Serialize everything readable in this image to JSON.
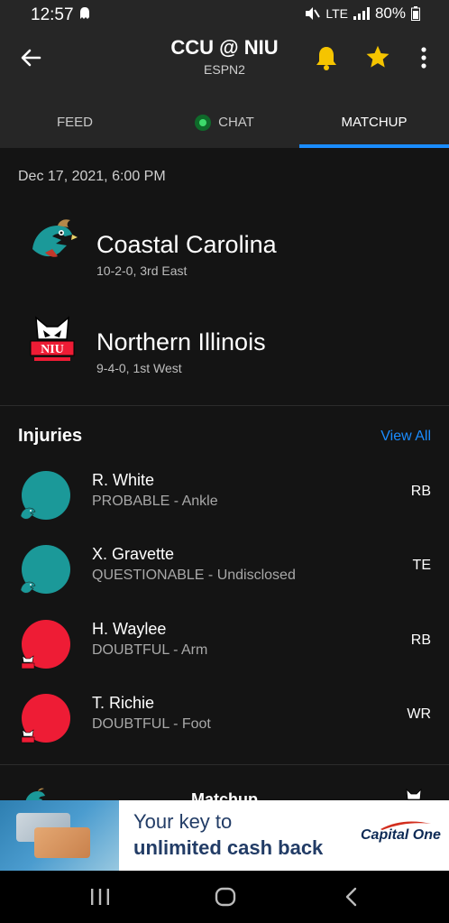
{
  "status_bar": {
    "time": "12:57",
    "signal_text": "LTE",
    "battery": "80%"
  },
  "header": {
    "title": "CCU @ NIU",
    "subtitle": "ESPN2"
  },
  "tabs": [
    {
      "label": "FEED"
    },
    {
      "label": "CHAT"
    },
    {
      "label": "MATCHUP"
    }
  ],
  "game": {
    "date": "Dec 17, 2021, 6:00 PM",
    "teams": [
      {
        "name": "Coastal Carolina",
        "record": "10-2-0, 3rd East",
        "logo_icon": "chanticleer-logo-icon"
      },
      {
        "name": "Northern Illinois",
        "record": "9-4-0, 1st West",
        "logo_icon": "huskie-logo-icon"
      }
    ]
  },
  "injuries": {
    "title": "Injuries",
    "view_all": "View All",
    "items": [
      {
        "name": "R. White",
        "status": "PROBABLE - Ankle",
        "position": "RB",
        "color": "#1b9999",
        "team": "ccu"
      },
      {
        "name": "X. Gravette",
        "status": "QUESTIONABLE - Undisclosed",
        "position": "TE",
        "color": "#1b9999",
        "team": "ccu"
      },
      {
        "name": "H. Waylee",
        "status": "DOUBTFUL - Arm",
        "position": "RB",
        "color": "#ee1c35",
        "team": "niu"
      },
      {
        "name": "T. Richie",
        "status": "DOUBTFUL - Foot",
        "position": "WR",
        "color": "#ee1c35",
        "team": "niu"
      }
    ]
  },
  "matchup_section": {
    "title": "Matchup"
  },
  "ad": {
    "line1": "Your key to",
    "line2": "unlimited cash back",
    "brand": "Capital One"
  },
  "colors": {
    "accent": "#1a8cff",
    "bell": "#f5c400",
    "star": "#f5c400",
    "ccu_teal": "#1b9999",
    "niu_red": "#ee1c35"
  }
}
